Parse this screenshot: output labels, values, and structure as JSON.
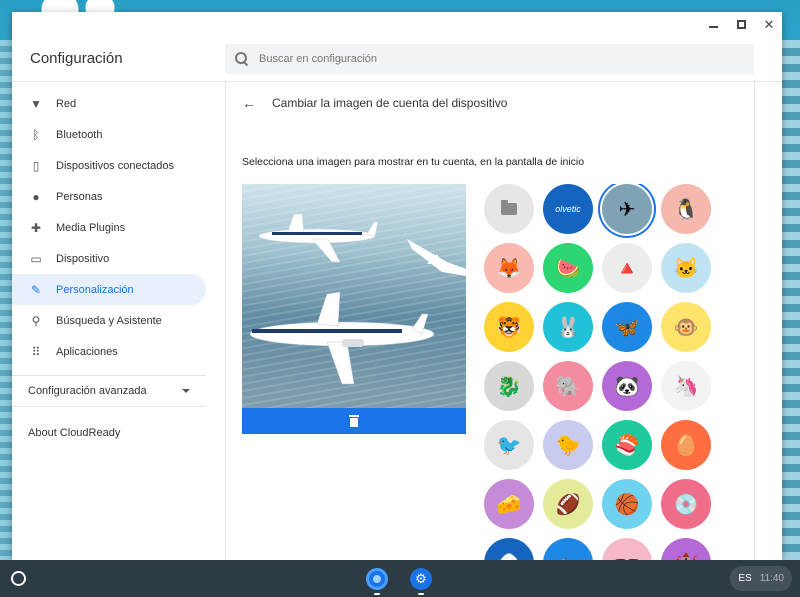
{
  "window": {
    "controls": {
      "minimize": "—",
      "maximize": "☐",
      "close": "✕"
    }
  },
  "header": {
    "title": "Configuración",
    "search_placeholder": "Buscar en configuración"
  },
  "sidebar": {
    "items": [
      {
        "label": "Red",
        "icon": "wifi-icon",
        "glyph": "▼"
      },
      {
        "label": "Bluetooth",
        "icon": "bluetooth-icon",
        "glyph": "ᛒ"
      },
      {
        "label": "Dispositivos conectados",
        "icon": "phone-icon",
        "glyph": "▯"
      },
      {
        "label": "Personas",
        "icon": "person-icon",
        "glyph": "●"
      },
      {
        "label": "Media Plugins",
        "icon": "puzzle-icon",
        "glyph": "✚"
      },
      {
        "label": "Dispositivo",
        "icon": "laptop-icon",
        "glyph": "▭"
      },
      {
        "label": "Personalización",
        "icon": "brush-icon",
        "glyph": "✎",
        "active": true
      },
      {
        "label": "Búsqueda y Asistente",
        "icon": "search-icon",
        "glyph": "⚲"
      },
      {
        "label": "Aplicaciones",
        "icon": "apps-grid-icon",
        "glyph": "⠿"
      }
    ],
    "advanced_label": "Configuración avanzada",
    "about_label": "About CloudReady"
  },
  "main": {
    "page_title": "Cambiar la imagen de cuenta del dispositivo",
    "instruction": "Selecciona una imagen para mostrar en tu cuenta, en la pantalla de inicio",
    "avatars": [
      {
        "name": "folder-avatar",
        "bg": "#e6e6e6",
        "glyph": ""
      },
      {
        "name": "solvetic-avatar",
        "bg": "#1565c0",
        "glyph": "",
        "text": "olvetic"
      },
      {
        "name": "airplane-photo-avatar",
        "bg": "#7fa2b5",
        "glyph": "✈",
        "selected": true
      },
      {
        "name": "penguin-avatar",
        "bg": "#f6b7ad",
        "glyph": "🐧"
      },
      {
        "name": "fox-avatar",
        "bg": "#f9b9b0",
        "glyph": "🦊"
      },
      {
        "name": "watermelon-avatar",
        "bg": "#2ed573",
        "glyph": "🍉"
      },
      {
        "name": "origami-bird-avatar",
        "bg": "#ececec",
        "glyph": "🔺"
      },
      {
        "name": "cat-avatar",
        "bg": "#bfe3f2",
        "glyph": "🐱"
      },
      {
        "name": "tiger-avatar",
        "bg": "#ffd233",
        "glyph": "🐯"
      },
      {
        "name": "rabbit-avatar",
        "bg": "#1fc2d6",
        "glyph": "🐰"
      },
      {
        "name": "butterfly-avatar",
        "bg": "#1e88e5",
        "glyph": "🦋"
      },
      {
        "name": "monkey-avatar",
        "bg": "#ffe46b",
        "glyph": "🐵"
      },
      {
        "name": "dragon-avatar",
        "bg": "#d8d8d8",
        "glyph": "🐉"
      },
      {
        "name": "elephant-avatar",
        "bg": "#f48ca0",
        "glyph": "🐘"
      },
      {
        "name": "panda-avatar",
        "bg": "#b46ad6",
        "glyph": "🐼"
      },
      {
        "name": "unicorn-avatar",
        "bg": "#f3f3f3",
        "glyph": "🦄"
      },
      {
        "name": "birds-avatar",
        "bg": "#e5e5e5",
        "glyph": "🐦"
      },
      {
        "name": "cardinal-avatar",
        "bg": "#c9cbee",
        "glyph": "🐤"
      },
      {
        "name": "sushi-plate-avatar",
        "bg": "#1ec99d",
        "glyph": "🍣"
      },
      {
        "name": "tamagotchi-avatar",
        "bg": "#ff6e40",
        "glyph": "🥚"
      },
      {
        "name": "cheese-avatar",
        "bg": "#c58bd9",
        "glyph": "🧀"
      },
      {
        "name": "football-avatar",
        "bg": "#e3eb9a",
        "glyph": "🏈"
      },
      {
        "name": "basketball-avatar",
        "bg": "#6fd2ef",
        "glyph": "🏀"
      },
      {
        "name": "vinyl-record-avatar",
        "bg": "#f06d8a",
        "glyph": "💿"
      },
      {
        "name": "sushi-roll-avatar",
        "bg": "#1565c0",
        "glyph": "🍙"
      },
      {
        "name": "bicycle-avatar",
        "bg": "#1e88e5",
        "glyph": "🚲"
      },
      {
        "name": "sunglasses-avatar",
        "bg": "#f6b7c6",
        "glyph": "🕶"
      },
      {
        "name": "castle-avatar",
        "bg": "#b46ad6",
        "glyph": "🏰"
      }
    ]
  },
  "shelf": {
    "tray_language": "ES",
    "tray_time": "11:40"
  },
  "colors": {
    "accent": "#1a73e8",
    "shelf": "#2d3b45"
  }
}
